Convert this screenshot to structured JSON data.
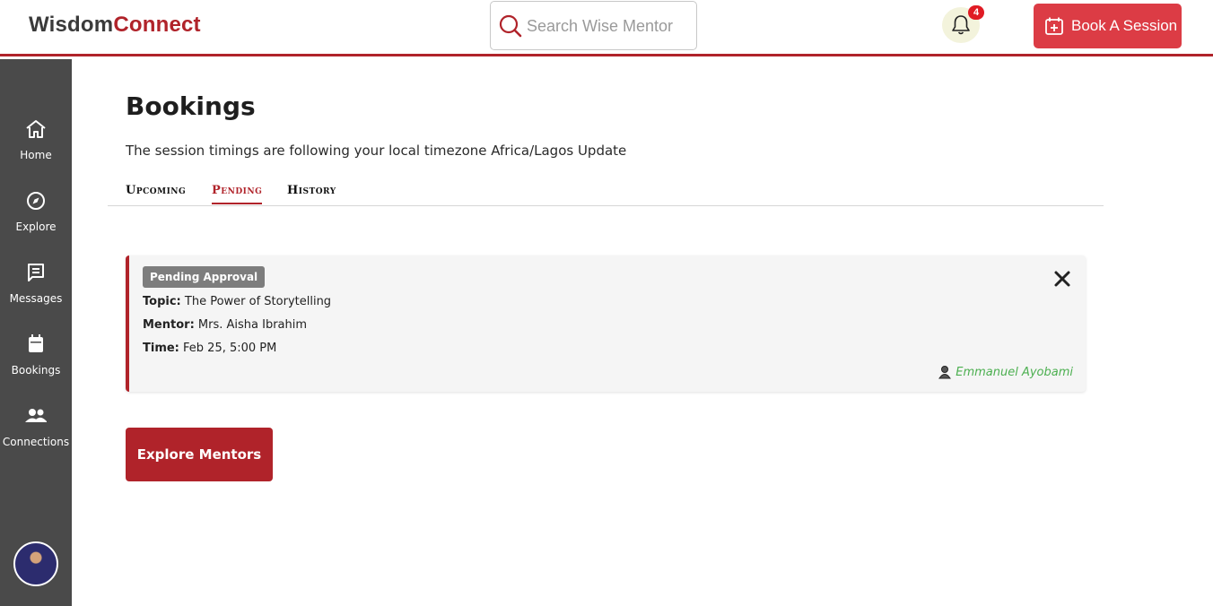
{
  "brand": {
    "part1": "Wisdom",
    "part2": "Connect"
  },
  "search": {
    "placeholder": "Search Wise Mentor"
  },
  "notifications": {
    "count": "4"
  },
  "header": {
    "book_label": "Book A Session"
  },
  "sidebar": {
    "items": [
      {
        "label": "Home",
        "icon": "home-icon"
      },
      {
        "label": "Explore",
        "icon": "compass-icon"
      },
      {
        "label": "Messages",
        "icon": "message-icon"
      },
      {
        "label": "Bookings",
        "icon": "calendar-icon"
      },
      {
        "label": "Connections",
        "icon": "users-icon"
      }
    ]
  },
  "main": {
    "title": "Bookings",
    "timezone_note": "The session timings are following your local timezone Africa/Lagos Update",
    "tabs": [
      {
        "label": "Upcoming",
        "active": false
      },
      {
        "label": "Pending",
        "active": true
      },
      {
        "label": "History",
        "active": false
      }
    ],
    "booking": {
      "status": "Pending Approval",
      "topic_label": "Topic:",
      "topic": "The Power of Storytelling",
      "mentor_label": "Mentor:",
      "mentor": "Mrs. Aisha Ibrahim",
      "time_label": "Time:",
      "time": "Feb 25, 5:00 PM",
      "mentee": "Emmanuel Ayobami"
    },
    "explore_label": "Explore Mentors"
  },
  "colors": {
    "brand_red": "#b0232a",
    "button_red": "#dc3c45",
    "sidebar": "#4a4a4a",
    "mentee_green": "#4caf50"
  }
}
